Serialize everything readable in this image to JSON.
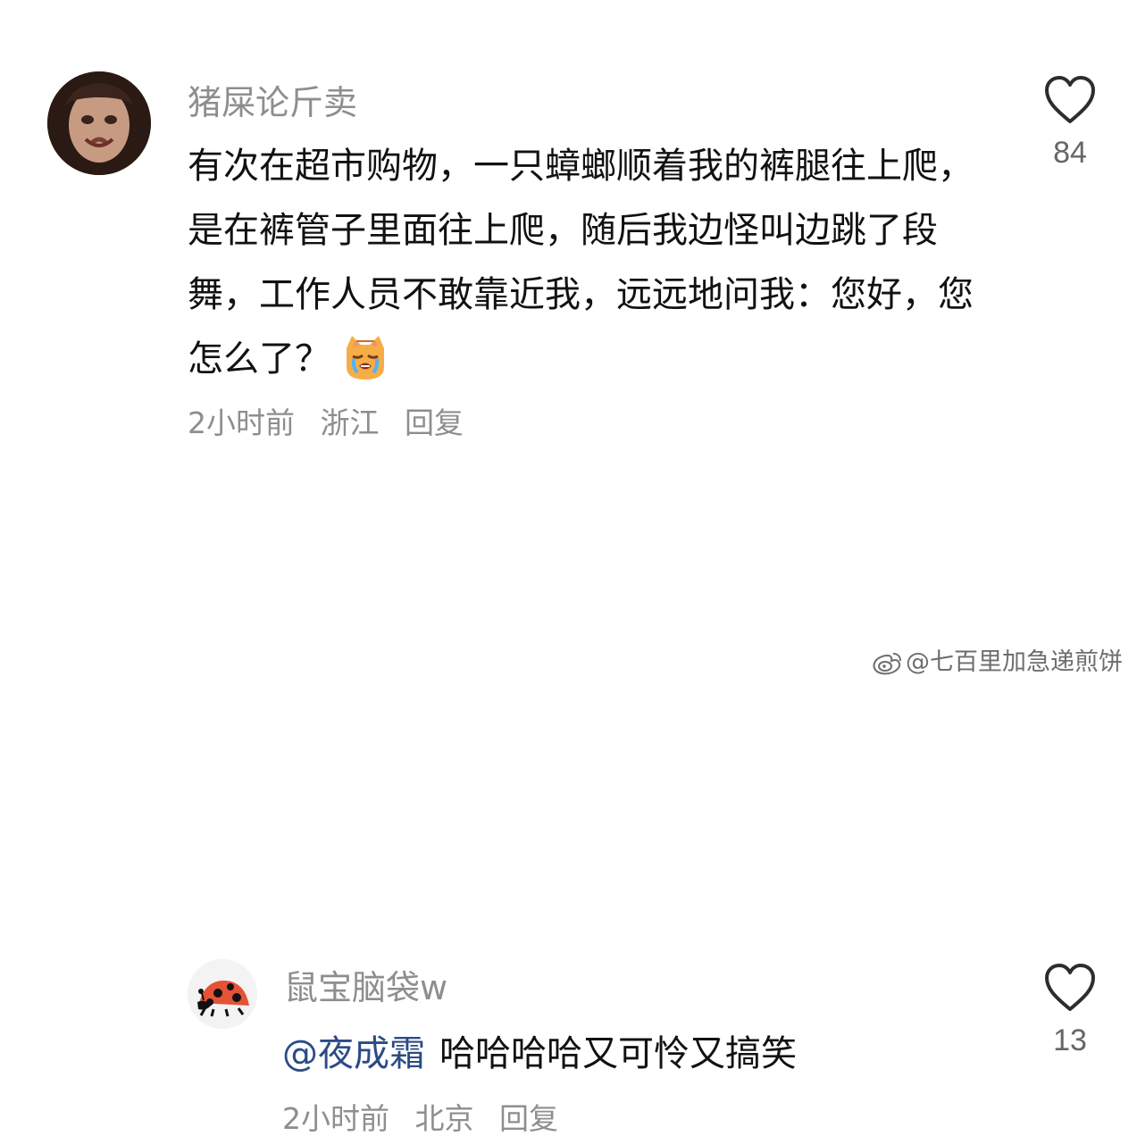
{
  "comments": {
    "main": {
      "username": "猪屎论斤卖",
      "text": "有次在超市购物，一只蟑螂顺着我的裤腿往上爬，是在裤管子里面往上爬，随后我边怪叫边跳了段舞，工作人员不敢靠近我，远远地问我：您好，您怎么了？",
      "time": "2小时前",
      "location": "浙江",
      "reply_label": "回复",
      "likes": "84"
    },
    "reply": {
      "username": "鼠宝脑袋w",
      "mention": "@夜成霜",
      "text": "哈哈哈哈又可怜又搞笑",
      "time": "2小时前",
      "location": "北京",
      "reply_label": "回复",
      "likes": "13"
    }
  },
  "icons": {
    "like": "heart-outline-icon",
    "emoji": "cat-crying-emoji-icon",
    "watermark": "weibo-icon"
  },
  "watermark": {
    "text": "@七百里加急递煎饼"
  },
  "colors": {
    "secondary_text": "#8e8e8e",
    "mention": "#2b4b86"
  }
}
